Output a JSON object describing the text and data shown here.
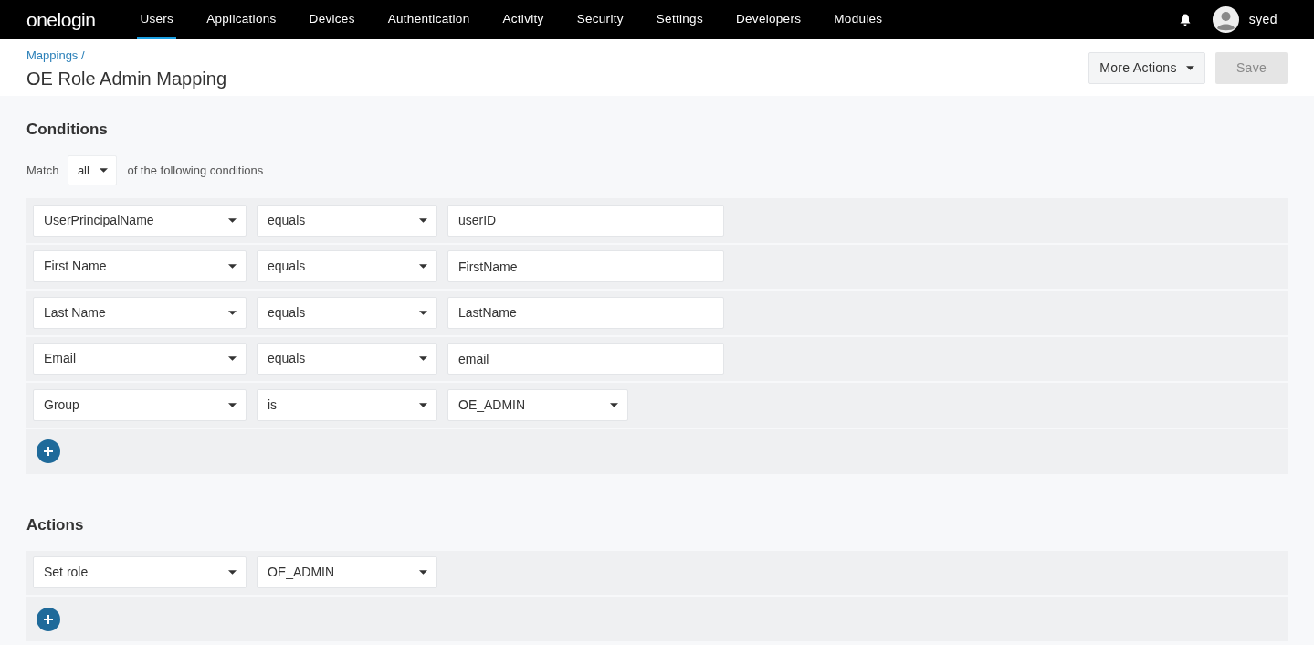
{
  "nav": {
    "logo": "onelogin",
    "items": [
      {
        "label": "Users",
        "selected": true
      },
      {
        "label": "Applications",
        "selected": false
      },
      {
        "label": "Devices",
        "selected": false
      },
      {
        "label": "Authentication",
        "selected": false
      },
      {
        "label": "Activity",
        "selected": false
      },
      {
        "label": "Security",
        "selected": false
      },
      {
        "label": "Settings",
        "selected": false
      },
      {
        "label": "Developers",
        "selected": false
      },
      {
        "label": "Modules",
        "selected": false
      }
    ],
    "user": "syed"
  },
  "header": {
    "breadcrumb": "Mappings /",
    "title": "OE Role Admin Mapping",
    "more_actions": "More Actions",
    "save": {
      "label": "Save",
      "disabled": true
    }
  },
  "conditions": {
    "title": "Conditions",
    "match_label": "Match",
    "match_value": "all",
    "match_suffix": "of the following conditions",
    "rows": [
      {
        "field": "UserPrincipalName",
        "operator": "equals",
        "value": {
          "kind": "input",
          "text": "userID"
        }
      },
      {
        "field": "First Name",
        "operator": "equals",
        "value": {
          "kind": "input",
          "text": "FirstName"
        }
      },
      {
        "field": "Last Name",
        "operator": "equals",
        "value": {
          "kind": "input",
          "text": "LastName"
        }
      },
      {
        "field": "Email",
        "operator": "equals",
        "value": {
          "kind": "input",
          "text": "email"
        }
      },
      {
        "field": "Group",
        "operator": "is",
        "value": {
          "kind": "select",
          "text": "OE_ADMIN"
        }
      }
    ]
  },
  "actions": {
    "title": "Actions",
    "rows": [
      {
        "action": "Set role",
        "value": "OE_ADMIN"
      }
    ]
  }
}
